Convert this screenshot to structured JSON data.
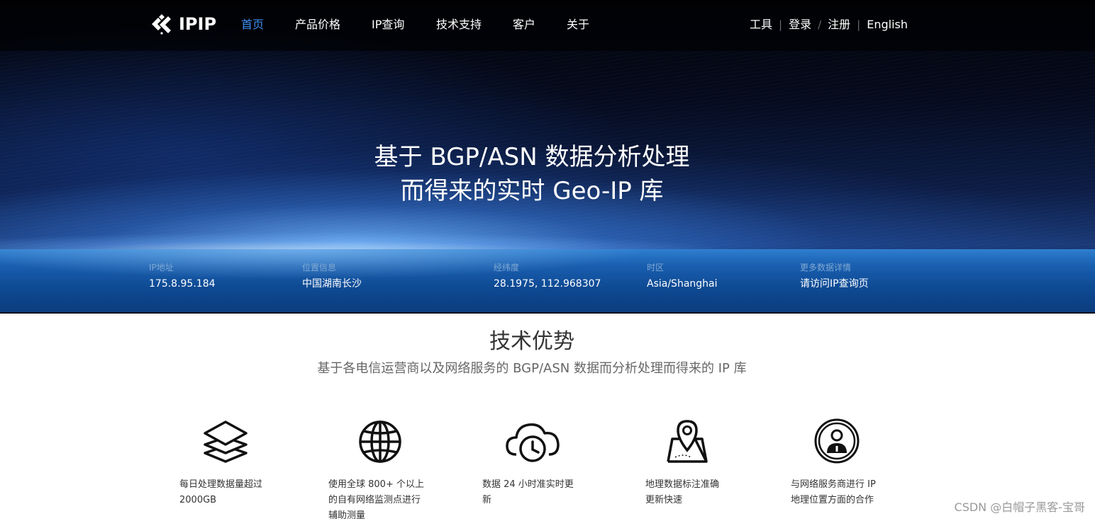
{
  "nav": {
    "logo_text": "IPIP",
    "items": [
      {
        "label": "首页",
        "active": true
      },
      {
        "label": "产品价格",
        "active": false
      },
      {
        "label": "IP查询",
        "active": false
      },
      {
        "label": "技术支持",
        "active": false
      },
      {
        "label": "客户",
        "active": false
      },
      {
        "label": "关于",
        "active": false
      }
    ],
    "right": {
      "tools": "工具",
      "login": "登录",
      "register": "注册",
      "language": "English",
      "sep_bar": "|",
      "sep_slash": "/"
    },
    "active_color": "#3d8ff0"
  },
  "hero": {
    "headline_line1": "基于 BGP/ASN 数据分析处理",
    "headline_line2": "而得来的实时 Geo-IP 库"
  },
  "info": [
    {
      "label": "IP地址",
      "value": "175.8.95.184"
    },
    {
      "label": "位置信息",
      "value": "中国湖南长沙"
    },
    {
      "label": "经纬度",
      "value": "28.1975, 112.968307"
    },
    {
      "label": "时区",
      "value": "Asia/Shanghai"
    },
    {
      "label": "更多数据详情",
      "value": "请访问IP查询页"
    }
  ],
  "features": {
    "title": "技术优势",
    "subtitle": "基于各电信运营商以及网络服务的 BGP/ASN 数据而分析处理而得来的 IP 库",
    "items": [
      {
        "icon": "layers-icon",
        "line1": "每日处理数据量超过",
        "line2": "2000GB",
        "line3": ""
      },
      {
        "icon": "globe-icon",
        "line1": "使用全球 800+ 个以上",
        "line2": "的自有网络监测点进行",
        "line3": "辅助测量"
      },
      {
        "icon": "cloud-clock-icon",
        "line1": "数据 24 小时准实时更",
        "line2": "新",
        "line3": ""
      },
      {
        "icon": "map-pin-icon",
        "line1": "地理数据标注准确",
        "line2": "更新快速",
        "line3": ""
      },
      {
        "icon": "user-badge-icon",
        "line1": "与网络服务商进行 IP",
        "line2": "地理位置方面的合作",
        "line3": ""
      }
    ]
  },
  "watermark": "CSDN @白帽子黑客-宝哥"
}
